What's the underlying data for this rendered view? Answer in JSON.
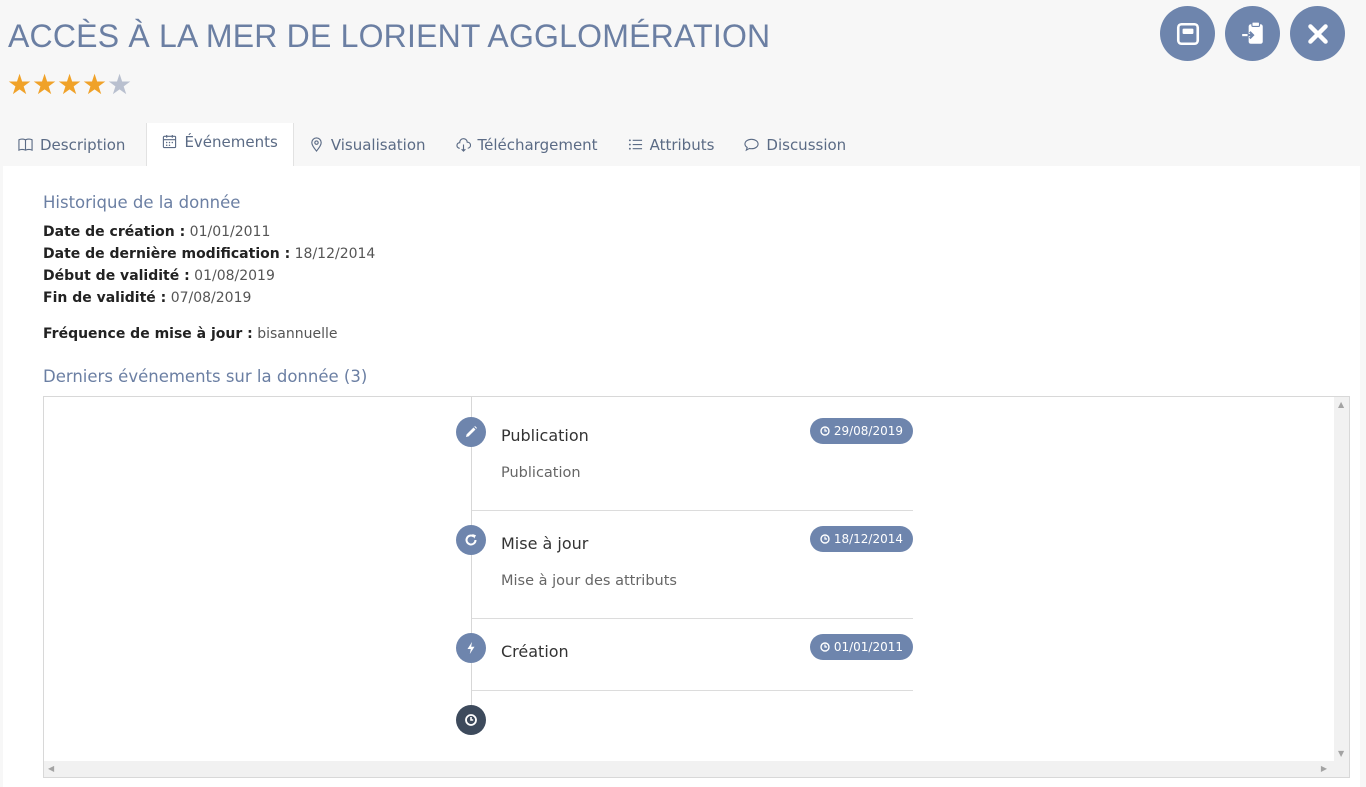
{
  "page_title": "ACCÈS À LA MER DE LORIENT AGGLOMÉRATION",
  "rating": {
    "value": 4,
    "max": 5
  },
  "actions": [
    {
      "name": "save-icon"
    },
    {
      "name": "clipboard-export-icon"
    },
    {
      "name": "close-icon"
    }
  ],
  "tabs": [
    {
      "label": "Description",
      "icon": "book-icon"
    },
    {
      "label": "Événements",
      "icon": "calendar-icon",
      "active": true
    },
    {
      "label": "Visualisation",
      "icon": "map-pin-icon"
    },
    {
      "label": "Téléchargement",
      "icon": "cloud-download-icon"
    },
    {
      "label": "Attributs",
      "icon": "list-icon"
    },
    {
      "label": "Discussion",
      "icon": "speech-bubble-icon"
    }
  ],
  "history": {
    "heading": "Historique de la donnée",
    "creation_label": "Date de création :",
    "creation_value": "01/01/2011",
    "modified_label": "Date de dernière modification :",
    "modified_value": "18/12/2014",
    "valid_start_label": "Début de validité :",
    "valid_start_value": "01/08/2019",
    "valid_end_label": "Fin de validité :",
    "valid_end_value": "07/08/2019",
    "frequency_label": "Fréquence de mise à jour :",
    "frequency_value": "bisannuelle"
  },
  "events": {
    "heading": "Derniers événements sur la donnée (3)",
    "items": [
      {
        "title": "Publication",
        "description": "Publication",
        "date": "29/08/2019",
        "icon": "pencil-icon"
      },
      {
        "title": "Mise à jour",
        "description": "Mise à jour des attributs",
        "date": "18/12/2014",
        "icon": "refresh-icon"
      },
      {
        "title": "Création",
        "description": "",
        "date": "01/01/2011",
        "icon": "lightning-icon"
      }
    ],
    "end_icon": "clock-icon"
  },
  "colors": {
    "accent": "#6e85ad",
    "star_on": "#f0a229",
    "star_off": "#b9c0cf",
    "heading": "#6b7fa3"
  }
}
